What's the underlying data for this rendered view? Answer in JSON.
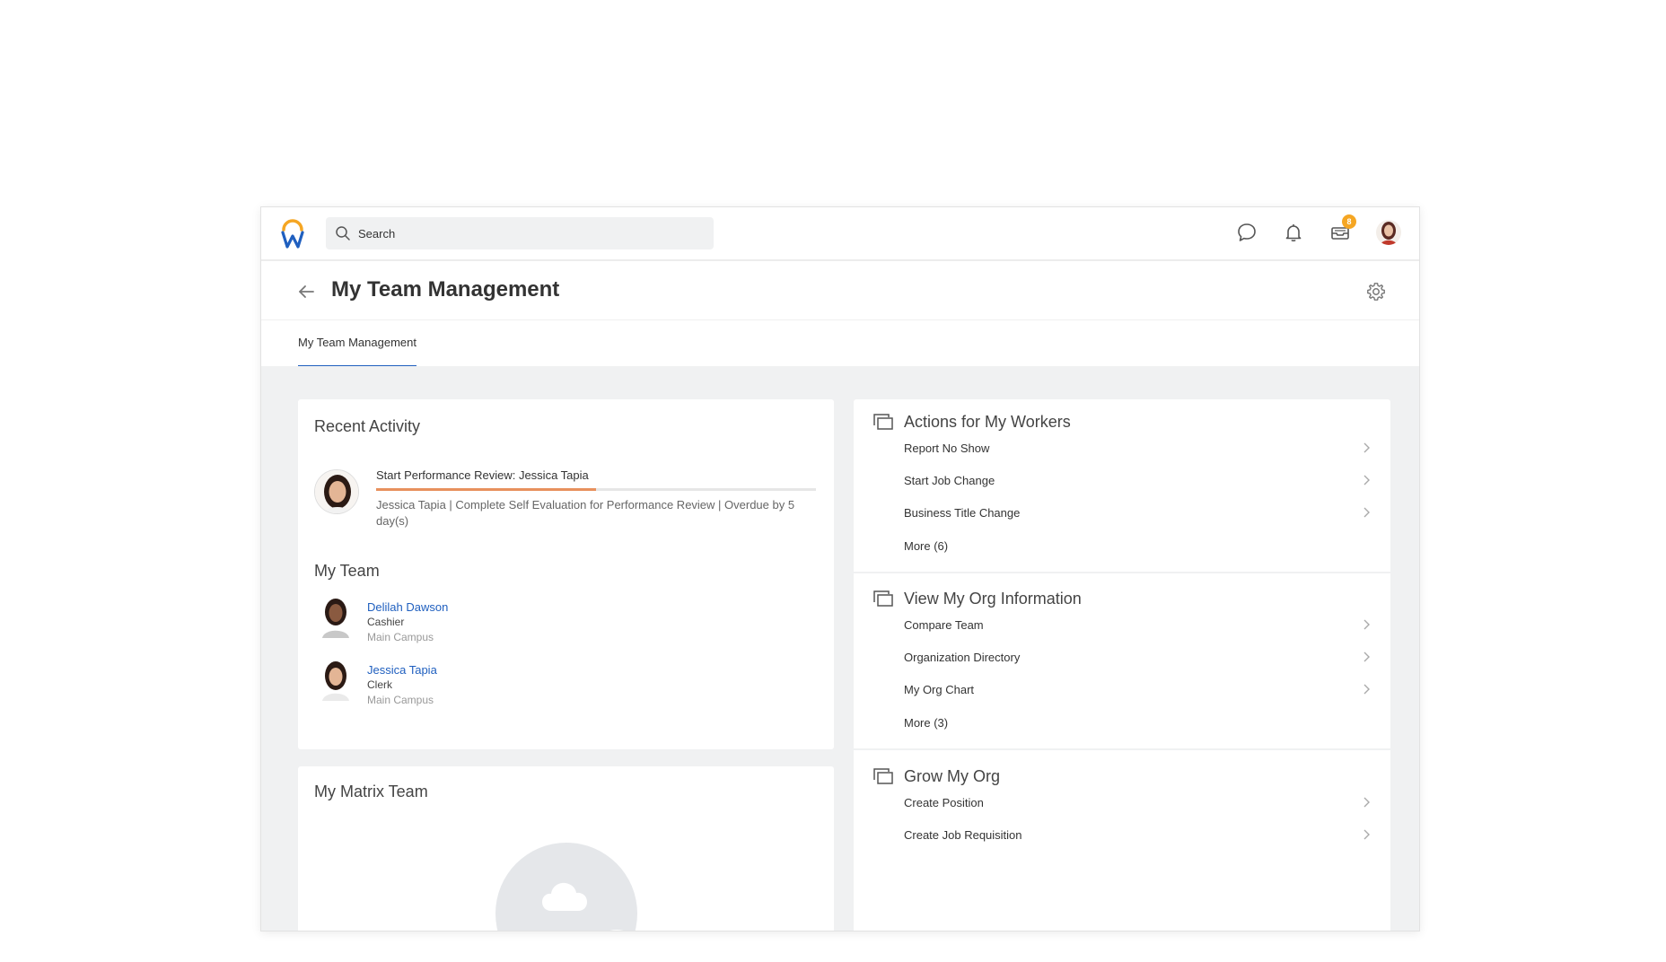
{
  "app": {
    "brand_color": "#1f5fbf",
    "accent_orange": "#f5a623"
  },
  "search": {
    "placeholder": "Search"
  },
  "header": {
    "inbox_badge": "8",
    "icons": [
      "chat-icon",
      "bell-icon",
      "inbox-icon",
      "user-avatar"
    ]
  },
  "page": {
    "title": "My Team Management"
  },
  "tabs": [
    {
      "label": "My Team Management",
      "active": true
    }
  ],
  "recent_activity": {
    "heading": "Recent Activity",
    "item": {
      "title": "Start Performance Review: Jessica Tapia",
      "progress": 0.5,
      "description": "Jessica Tapia | Complete Self Evaluation for Performance Review | Overdue by 5 day(s)"
    }
  },
  "my_team": {
    "heading": "My Team",
    "members": [
      {
        "name": "Delilah Dawson",
        "role": "Cashier",
        "location": "Main Campus"
      },
      {
        "name": "Jessica Tapia",
        "role": "Clerk",
        "location": "Main Campus"
      }
    ]
  },
  "matrix_team": {
    "heading": "My Matrix Team"
  },
  "actions_for_workers": {
    "heading": "Actions for My Workers",
    "items": [
      "Report No Show",
      "Start Job Change",
      "Business Title Change"
    ],
    "more": "More (6)"
  },
  "view_org": {
    "heading": "View My Org Information",
    "items": [
      "Compare Team",
      "Organization Directory",
      "My Org Chart"
    ],
    "more": "More (3)"
  },
  "grow_org": {
    "heading": "Grow My Org",
    "items": [
      "Create Position",
      "Create Job Requisition"
    ]
  }
}
